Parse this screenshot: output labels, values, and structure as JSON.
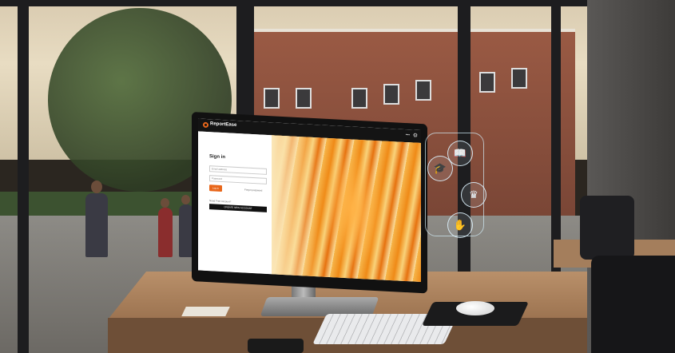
{
  "screen": {
    "brand": "ReportEase",
    "topbar_menu": "•••",
    "signin": {
      "title": "Sign in",
      "email_placeholder": "Email address",
      "password_placeholder": "Password",
      "login_label": "Log in",
      "forgot_label": "Forgot password",
      "no_account_label": "Need Free Account?",
      "create_label": "CREATE NEW ACCOUNT"
    }
  },
  "hologram_icons": [
    "graduation-cap-icon",
    "book-icon",
    "crown-icon",
    "hand-gesture-icon"
  ],
  "colors": {
    "accent": "#e8661a",
    "art_orange": "#ef8a17"
  }
}
